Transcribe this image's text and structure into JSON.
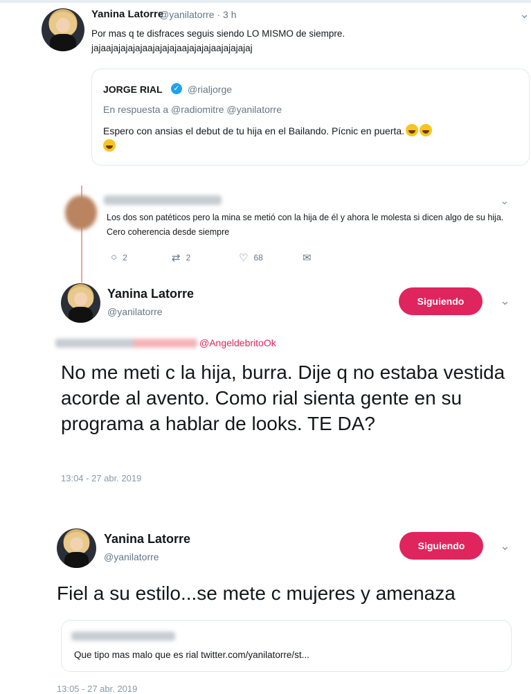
{
  "tweet1": {
    "name": "Yanina Latorre",
    "handle_time": "@yanilatorre · 3 h",
    "text_line1": "Por mas q te disfraces seguis siendo LO MISMO de siempre.",
    "text_line2": "jajaajajajajajaajajajajaajajajajaajajajajaj"
  },
  "quote": {
    "name": "JORGE RIAL",
    "verified": "✓",
    "handle": "@rialjorge",
    "reply": "En respuesta a @radiomitre @yanilatorre",
    "text": "Espero con ansias el debut de tu hija en el Bailando. Pícnic en puerta."
  },
  "reply_tweet": {
    "text": "Los dos son patéticos pero la mina se metió con la hija de él y ahora le molesta si dicen algo de su hija. Cero coherencia desde siempre",
    "replies": "2",
    "retweets": "2",
    "likes": "68"
  },
  "tweet2": {
    "name": "Yanina Latorre",
    "handle": "@yanilatorre",
    "follow_label": "Siguiendo",
    "reply_to": "@AngeldebritoOk",
    "text": "No me meti c la hija, burra. Dije q no estaba vestida acorde al avento. Como rial sienta gente en su programa a hablar de looks. TE DA?",
    "timestamp": "13:04 - 27 abr. 2019"
  },
  "tweet3": {
    "name": "Yanina Latorre",
    "handle": "@yanilatorre",
    "follow_label": "Siguiendo",
    "text": "Fiel a su estilo...se mete c mujeres y amenaza",
    "link_text": "Que tipo mas malo que es rial twitter.com/yanilatorre/st...",
    "timestamp": "13:05 - 27 abr. 2019"
  },
  "icons": {
    "chevron": "⌄",
    "reply": "○",
    "retweet": "⇄",
    "like": "♡",
    "dm": "✉"
  },
  "colors": {
    "accent": "#e0245e",
    "verified": "#1da1f2",
    "muted": "#657786"
  }
}
